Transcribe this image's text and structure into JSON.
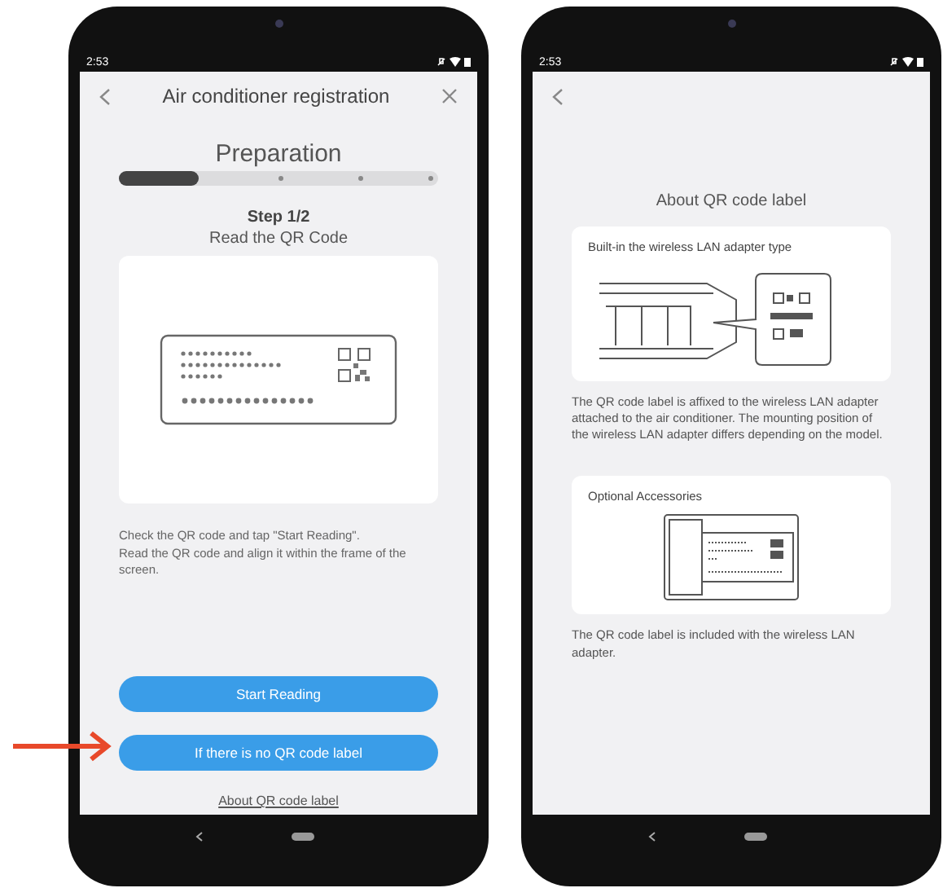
{
  "registration_screen": {
    "status_bar": {
      "time": "2:53"
    },
    "header": {
      "title": "Air conditioner registration"
    },
    "progress": {
      "label": "Preparation",
      "level": 0.25
    },
    "step": {
      "number": "Step 1/2",
      "title": "Read the QR Code"
    },
    "instructions": "Check the QR code and tap \"Start Reading\".\nRead the QR code and align it within the frame of the screen.",
    "buttons": [
      {
        "label": "Start Reading"
      },
      {
        "label": "If there is no QR code label"
      }
    ],
    "link": "About QR code label"
  },
  "qr_info_screen": {
    "status_bar": {
      "time": "2:53"
    },
    "title": "About QR code label",
    "cards": [
      {
        "kind": "builtin",
        "caption": "Built-in the wireless LAN adapter type",
        "note": "The QR code label is affixed to the wireless LAN adapter attached to the air conditioner. The mounting position of the wireless LAN adapter differs depending on the model."
      },
      {
        "kind": "accessory",
        "caption": "Optional Accessories",
        "note": "The QR code label is included with the wireless LAN adapter."
      }
    ]
  }
}
